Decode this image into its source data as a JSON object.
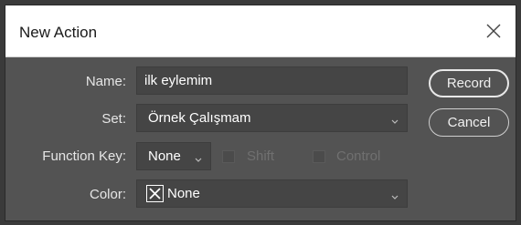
{
  "dialog": {
    "title": "New Action",
    "close_icon": "close-x-icon"
  },
  "form": {
    "name_label": "Name:",
    "name_value": "ilk eylemim",
    "set_label": "Set:",
    "set_value": "Örnek Çalışmam",
    "function_key_label": "Function Key:",
    "function_key_value": "None",
    "shift_label": "Shift",
    "control_label": "Control",
    "color_label": "Color:",
    "color_value": "None",
    "color_icon": "no-color-x-icon"
  },
  "buttons": {
    "record": "Record",
    "cancel": "Cancel"
  },
  "colors": {
    "dialog_bg": "#535353",
    "field_bg": "#454545",
    "title_bg": "#ffffff"
  }
}
